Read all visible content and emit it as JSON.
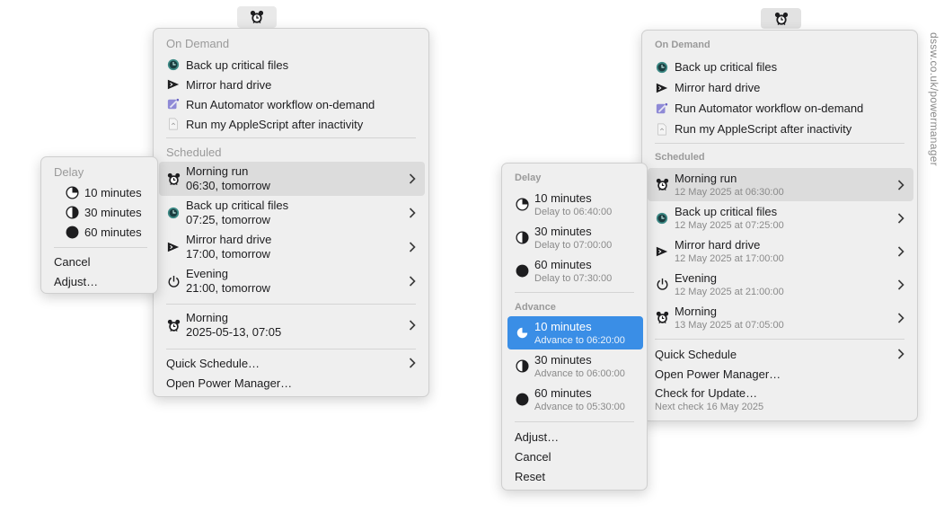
{
  "left": {
    "menu": {
      "on_demand_header": "On Demand",
      "on_demand": [
        {
          "label": "Back up critical files",
          "icon": "time-machine-icon"
        },
        {
          "label": "Mirror hard drive",
          "icon": "terminal-icon"
        },
        {
          "label": "Run Automator workflow on-demand",
          "icon": "automator-icon"
        },
        {
          "label": "Run my AppleScript after inactivity",
          "icon": "script-icon"
        }
      ],
      "scheduled_header": "Scheduled",
      "scheduled": [
        {
          "label": "Morning run",
          "detail": "06:30, tomorrow",
          "icon": "alarm-clock-icon"
        },
        {
          "label": "Back up critical files",
          "detail": "07:25, tomorrow",
          "icon": "time-machine-icon"
        },
        {
          "label": "Mirror hard drive",
          "detail": "17:00, tomorrow",
          "icon": "terminal-icon"
        },
        {
          "label": "Evening",
          "detail": "21:00, tomorrow",
          "icon": "power-icon"
        }
      ],
      "later": {
        "label": "Morning",
        "detail": "2025-05-13, 07:05",
        "icon": "alarm-clock-icon"
      },
      "quick_schedule": "Quick Schedule…",
      "open_pm": "Open Power Manager…"
    },
    "submenu": {
      "delay_header": "Delay",
      "delay": [
        {
          "label": "10 minutes",
          "icon": "quarter-clock-icon"
        },
        {
          "label": "30 minutes",
          "icon": "half-circle-icon"
        },
        {
          "label": "60 minutes",
          "icon": "full-circle-icon"
        }
      ],
      "cancel": "Cancel",
      "adjust": "Adjust…"
    }
  },
  "right": {
    "menu": {
      "on_demand_header": "On Demand",
      "on_demand": [
        {
          "label": "Back up critical files",
          "icon": "time-machine-icon"
        },
        {
          "label": "Mirror hard drive",
          "icon": "terminal-icon"
        },
        {
          "label": "Run Automator workflow on-demand",
          "icon": "automator-icon"
        },
        {
          "label": "Run my AppleScript after inactivity",
          "icon": "script-icon"
        }
      ],
      "scheduled_header": "Scheduled",
      "scheduled": [
        {
          "label": "Morning run",
          "detail": "12 May 2025 at 06:30:00",
          "icon": "alarm-clock-icon"
        },
        {
          "label": "Back up critical files",
          "detail": "12 May 2025 at 07:25:00",
          "icon": "time-machine-icon"
        },
        {
          "label": "Mirror hard drive",
          "detail": "12 May 2025 at 17:00:00",
          "icon": "terminal-icon"
        },
        {
          "label": "Evening",
          "detail": "12 May 2025 at 21:00:00",
          "icon": "power-icon"
        },
        {
          "label": "Morning",
          "detail": "13 May 2025 at 07:05:00",
          "icon": "alarm-clock-icon"
        }
      ],
      "quick_schedule": "Quick Schedule",
      "open_pm": "Open Power Manager…",
      "check_update": "Check for Update…",
      "next_check": "Next check 16 May 2025"
    },
    "submenu": {
      "delay_header": "Delay",
      "delay": [
        {
          "label": "10 minutes",
          "detail": "Delay to 06:40:00",
          "icon": "quarter-clock-icon"
        },
        {
          "label": "30 minutes",
          "detail": "Delay to 07:00:00",
          "icon": "half-circle-icon"
        },
        {
          "label": "60 minutes",
          "detail": "Delay to 07:30:00",
          "icon": "full-circle-icon"
        }
      ],
      "advance_header": "Advance",
      "advance": [
        {
          "label": "10 minutes",
          "detail": "Advance to 06:20:00",
          "icon": "quarter-clock-icon"
        },
        {
          "label": "30 minutes",
          "detail": "Advance to 06:00:00",
          "icon": "half-circle-icon"
        },
        {
          "label": "60 minutes",
          "detail": "Advance to 05:30:00",
          "icon": "full-circle-icon"
        }
      ],
      "adjust": "Adjust…",
      "cancel": "Cancel",
      "reset": "Reset"
    }
  },
  "watermark": "dssw.co.uk/powermanager",
  "colors": {
    "selection": "#3a8ee6",
    "menu_bg": "#efefef",
    "section_header": "#9a9a9a"
  }
}
